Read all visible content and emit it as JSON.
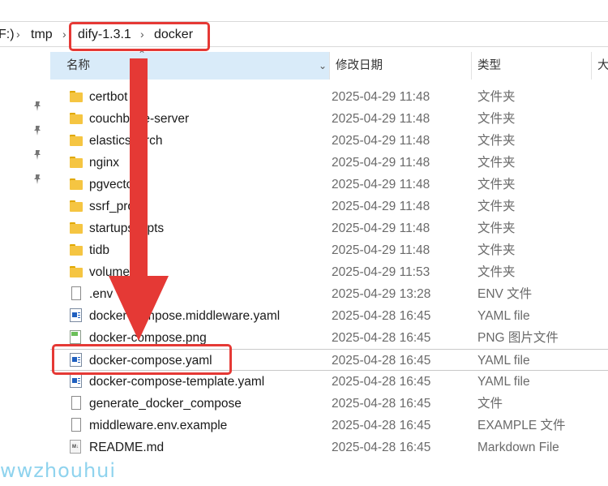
{
  "breadcrumb": {
    "drive_fragment": "F:)",
    "items": [
      "tmp",
      "dify-1.3.1",
      "docker"
    ]
  },
  "columns": {
    "name": "名称",
    "date": "修改日期",
    "type": "类型",
    "size": "大"
  },
  "files": [
    {
      "name": "certbot",
      "date": "2025-04-29 11:48",
      "type": "文件夹",
      "icon": "folder-icon"
    },
    {
      "name": "couchbase-server",
      "date": "2025-04-29 11:48",
      "type": "文件夹",
      "icon": "folder-icon"
    },
    {
      "name": "elasticsearch",
      "date": "2025-04-29 11:48",
      "type": "文件夹",
      "icon": "folder-icon"
    },
    {
      "name": "nginx",
      "date": "2025-04-29 11:48",
      "type": "文件夹",
      "icon": "folder-icon"
    },
    {
      "name": "pgvector",
      "date": "2025-04-29 11:48",
      "type": "文件夹",
      "icon": "folder-icon"
    },
    {
      "name": "ssrf_proxy",
      "date": "2025-04-29 11:48",
      "type": "文件夹",
      "icon": "folder-icon"
    },
    {
      "name": "startupscripts",
      "date": "2025-04-29 11:48",
      "type": "文件夹",
      "icon": "folder-icon"
    },
    {
      "name": "tidb",
      "date": "2025-04-29 11:48",
      "type": "文件夹",
      "icon": "folder-icon"
    },
    {
      "name": "volumes",
      "date": "2025-04-29 11:53",
      "type": "文件夹",
      "icon": "folder-icon"
    },
    {
      "name": ".env",
      "date": "2025-04-29 13:28",
      "type": "ENV 文件",
      "icon": "file-icon"
    },
    {
      "name": "docker-compose.middleware.yaml",
      "date": "2025-04-28 16:45",
      "type": "YAML file",
      "icon": "yaml-file-icon"
    },
    {
      "name": "docker-compose.png",
      "date": "2025-04-28 16:45",
      "type": "PNG 图片文件",
      "icon": "image-file-icon"
    },
    {
      "name": "docker-compose.yaml",
      "date": "2025-04-28 16:45",
      "type": "YAML file",
      "icon": "yaml-file-icon"
    },
    {
      "name": "docker-compose-template.yaml",
      "date": "2025-04-28 16:45",
      "type": "YAML file",
      "icon": "yaml-file-icon"
    },
    {
      "name": "generate_docker_compose",
      "date": "2025-04-28 16:45",
      "type": "文件",
      "icon": "file-icon"
    },
    {
      "name": "middleware.env.example",
      "date": "2025-04-28 16:45",
      "type": "EXAMPLE 文件",
      "icon": "file-icon"
    },
    {
      "name": "README.md",
      "date": "2025-04-28 16:45",
      "type": "Markdown File",
      "icon": "markdown-file-icon"
    }
  ],
  "md_icon_text": "M↓",
  "annotations": {
    "arrow_color": "#e53935",
    "highlight_color": "#e53935"
  },
  "watermark": "wwzhouhui"
}
